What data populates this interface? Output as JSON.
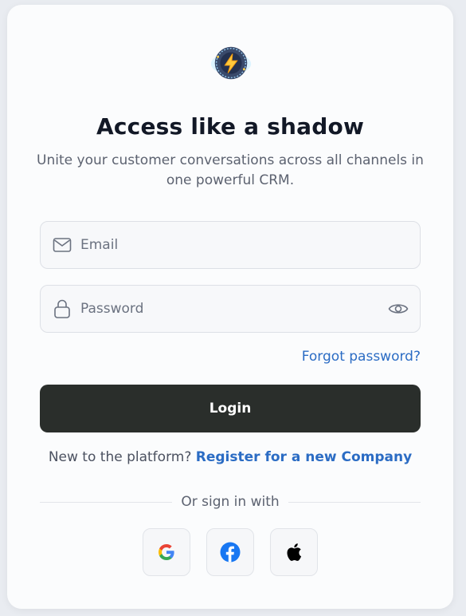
{
  "title": "Access like a shadow",
  "subtitle": "Unite your customer conversations across all channels in one powerful CRM.",
  "email": {
    "placeholder": "Email",
    "value": "",
    "icon": "mail-icon"
  },
  "password": {
    "placeholder": "Password",
    "value": "",
    "icon": "lock-icon",
    "toggle_icon": "eye-icon"
  },
  "forgot_label": "Forgot password?",
  "login_label": "Login",
  "register": {
    "prompt": "New to the platform?",
    "link_label": "Register for a new Company"
  },
  "divider_label": "Or sign in with",
  "social": [
    "google-icon",
    "facebook-icon",
    "apple-icon"
  ],
  "colors": {
    "primary_button": "#2a2e2b",
    "link": "#2b6cc4",
    "facebook": "#1877f2"
  }
}
